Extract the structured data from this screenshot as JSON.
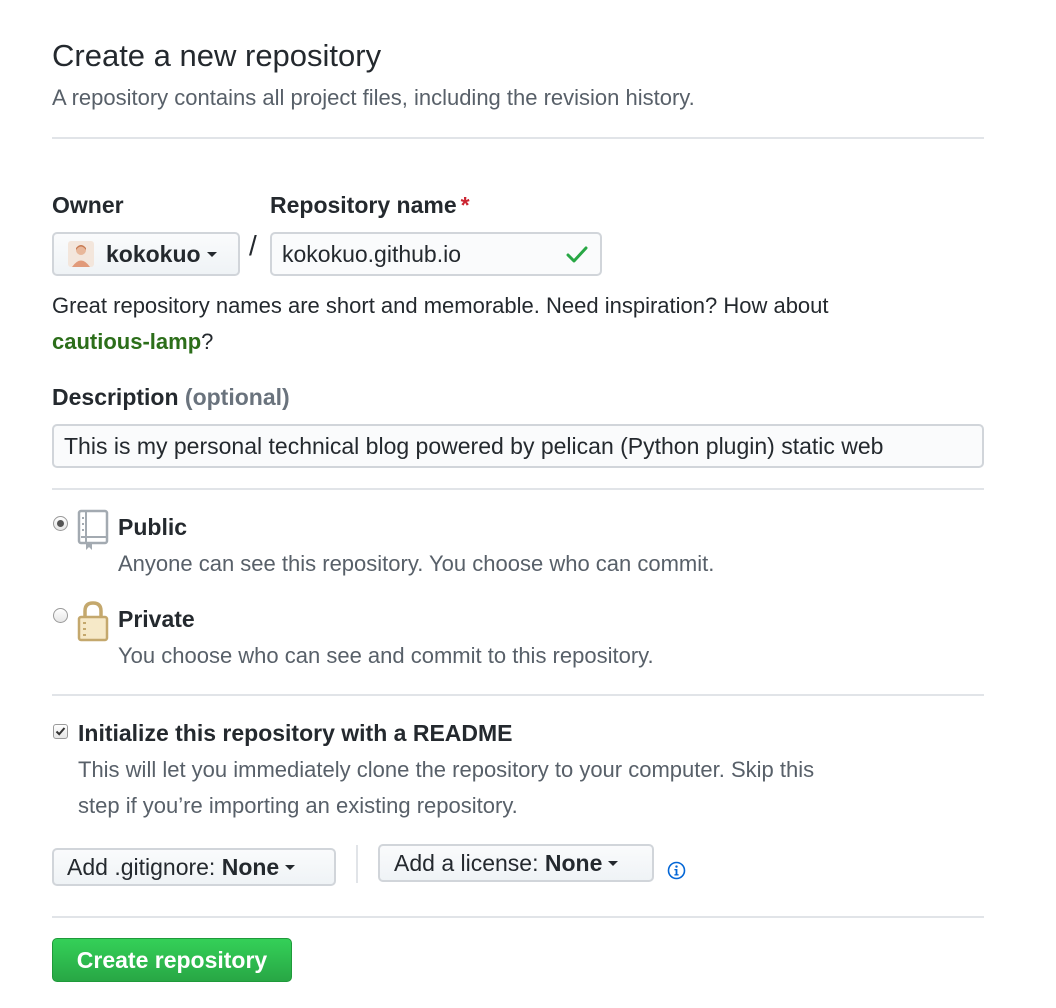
{
  "header": {
    "title": "Create a new repository",
    "subtitle": "A repository contains all project files, including the revision history."
  },
  "owner": {
    "label": "Owner",
    "value": "kokokuo"
  },
  "repo_name": {
    "label": "Repository name",
    "required_mark": "*",
    "separator": "/",
    "value": "kokokuo.github.io",
    "valid_icon": "check-icon"
  },
  "name_help": {
    "text": "Great repository names are short and memorable. Need inspiration? How about",
    "suggestion": "cautious-lamp",
    "suffix": "?"
  },
  "description": {
    "label": "Description",
    "optional_text": "(optional)",
    "value": "This is my personal technical blog powered by pelican (Python plugin) static web"
  },
  "visibility": {
    "public": {
      "title": "Public",
      "desc": "Anyone can see this repository. You choose who can commit.",
      "icon": "repo-book-icon",
      "selected": true
    },
    "private": {
      "title": "Private",
      "desc": "You choose who can see and commit to this repository.",
      "icon": "lock-icon",
      "selected": false
    }
  },
  "readme": {
    "title": "Initialize this repository with a README",
    "desc_line1": "This will let you immediately clone the repository to your computer. Skip this",
    "desc_line2": "step if you’re importing an existing repository.",
    "checked": true
  },
  "gitignore": {
    "prefix": "Add .gitignore:",
    "value": "None"
  },
  "license": {
    "prefix": "Add a license:",
    "value": "None",
    "info_icon": "info-icon"
  },
  "submit": {
    "label": "Create repository"
  },
  "colors": {
    "primary_green": "#28a745",
    "link_green": "#2c6e1a",
    "required_red": "#cb2431",
    "info_blue": "#0366d6"
  }
}
